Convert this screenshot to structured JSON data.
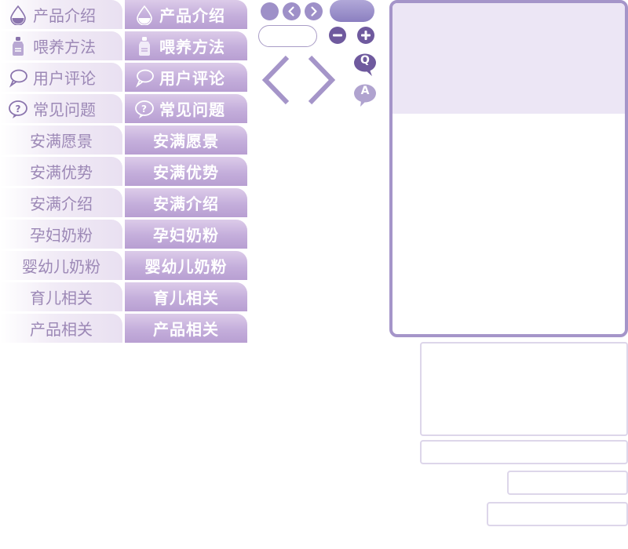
{
  "nav_top": [
    {
      "label": "产品介绍",
      "icon": "drop-icon"
    },
    {
      "label": "喂养方法",
      "icon": "bottle-icon"
    },
    {
      "label": "用户评论",
      "icon": "chat-bubble-icon"
    },
    {
      "label": "常见问题",
      "icon": "question-icon"
    }
  ],
  "nav_bottom": [
    {
      "label": "安满愿景"
    },
    {
      "label": "安满优势"
    },
    {
      "label": "安满介绍"
    },
    {
      "label": "孕妇奶粉"
    },
    {
      "label": "婴幼儿奶粉"
    },
    {
      "label": "育儿相关"
    },
    {
      "label": "产品相关"
    }
  ],
  "controls": {
    "q_label": "Q",
    "a_label": "A"
  },
  "colors": {
    "accent": "#a595c9",
    "panel_header": "#ece6f5",
    "nav_text": "#9c88b6",
    "icon_dark": "#6f5a9e"
  }
}
